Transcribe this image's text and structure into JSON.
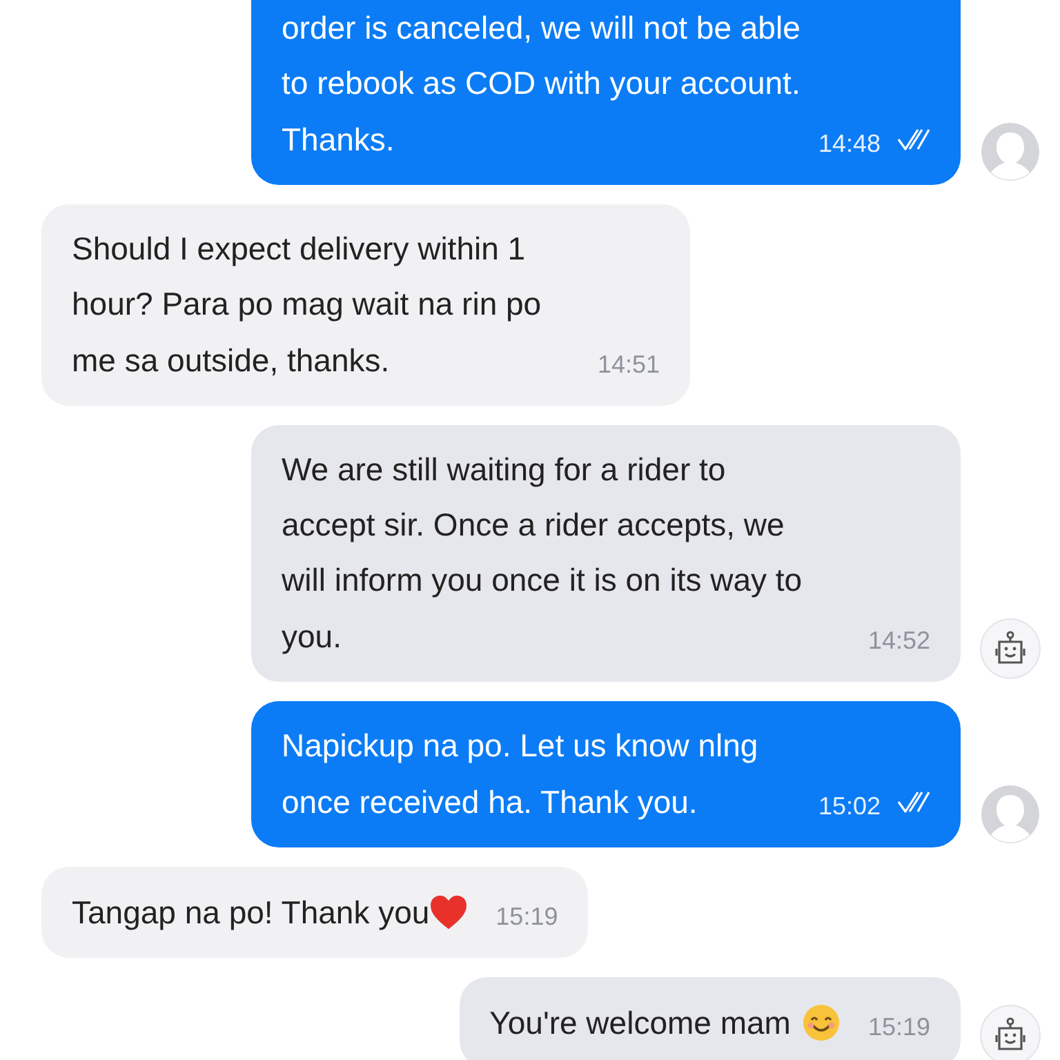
{
  "messages": [
    {
      "kind": "me",
      "lines": [
        "order is canceled, we will not be able",
        "to rebook as COD with your account.",
        "Thanks."
      ],
      "time": "14:48",
      "read": true,
      "cut_top": true
    },
    {
      "kind": "them",
      "lines": [
        "Should I expect delivery within 1",
        "hour? Para po mag wait na rin po",
        "me sa outside, thanks."
      ],
      "time": "14:51"
    },
    {
      "kind": "bot",
      "lines": [
        "We are still waiting for a rider to",
        "accept sir. Once a rider accepts, we",
        "will inform you once it is on its way to",
        "you."
      ],
      "time": "14:52"
    },
    {
      "kind": "me",
      "lines": [
        "Napickup na po. Let us know nlng",
        "once received ha. Thank you."
      ],
      "time": "15:02",
      "read": true
    },
    {
      "kind": "them",
      "lines": [
        "Tangap na po! Thank you"
      ],
      "emoji": {
        "kind": "heart"
      },
      "time": "15:19"
    },
    {
      "kind": "bot",
      "lines": [
        "You're welcome mam"
      ],
      "emoji": {
        "kind": "smile"
      },
      "time": "15:19"
    }
  ]
}
